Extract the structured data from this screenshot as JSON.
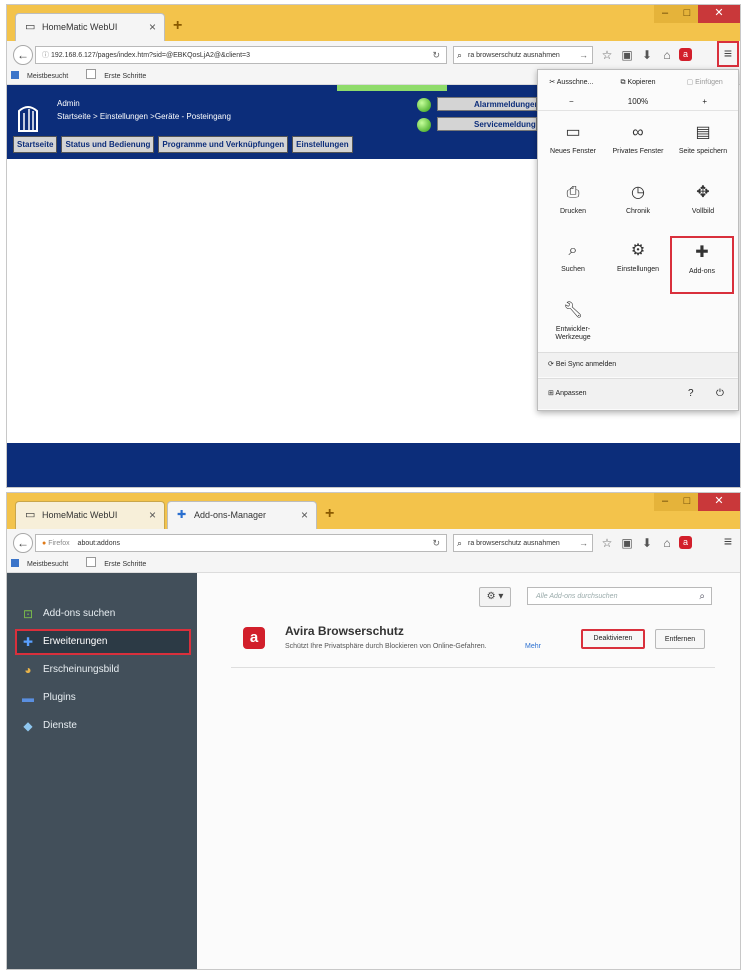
{
  "shot1": {
    "tabs": [
      {
        "label": "HomeMatic WebUI",
        "active": true
      }
    ],
    "new_tab": "+",
    "window_controls": {
      "minimize": "–",
      "maximize": "□",
      "close": "✕"
    },
    "url": "192.168.6.127/pages/index.htm?sid=@EBKQosLjA2@&client=3",
    "search_value": "ra browserschutz ausnahmen",
    "bookmarks": [
      "Meistbesucht",
      "Erste Schritte"
    ],
    "homematic": {
      "user": "Admin",
      "breadcrumb": "Startseite > Einstellungen >Geräte - Posteingang",
      "nav_tabs": [
        "Startseite",
        "Status und Bedienung",
        "Programme und Verknüpfungen",
        "Einstellungen"
      ],
      "status_buttons": [
        "Alarmmeldungen",
        "Servicemeldungen"
      ],
      "status_color": "#3fbe1a",
      "header_color": "#0c2d7a"
    },
    "menu_panel": {
      "edit_buttons": [
        "Ausschne...",
        "Kopieren",
        "Einfügen"
      ],
      "zoom": {
        "minus": "−",
        "level": "100%",
        "plus": "+"
      },
      "items": [
        {
          "label": "Neues Fenster",
          "icon": "window-icon"
        },
        {
          "label": "Privates Fenster",
          "icon": "mask-icon"
        },
        {
          "label": "Seite speichern",
          "icon": "save-page-icon"
        },
        {
          "label": "Drucken",
          "icon": "printer-icon"
        },
        {
          "label": "Chronik",
          "icon": "history-clock-icon"
        },
        {
          "label": "Vollbild",
          "icon": "fullscreen-icon"
        },
        {
          "label": "Suchen",
          "icon": "search-icon"
        },
        {
          "label": "Einstellungen",
          "icon": "gear-icon"
        },
        {
          "label": "Add-ons",
          "icon": "puzzle-icon",
          "highlighted": true
        },
        {
          "label": "Entwickler-Werkzeuge",
          "icon": "wrench-icon"
        }
      ],
      "sync": "Bei Sync anmelden",
      "customize": "Anpassen",
      "help": "?",
      "quit": "⏻"
    },
    "highlight_color": "#d9303c"
  },
  "shot2": {
    "tabs": [
      {
        "label": "HomeMatic WebUI",
        "active": false
      },
      {
        "label": "Add-ons-Manager",
        "active": true
      }
    ],
    "new_tab": "+",
    "window_controls": {
      "minimize": "–",
      "maximize": "□",
      "close": "✕"
    },
    "identity": "Firefox",
    "url": "about:addons",
    "search_value": "ra browserschutz ausnahmen",
    "bookmarks": [
      "Meistbesucht",
      "Erste Schritte"
    ],
    "categories": [
      {
        "label": "Add-ons suchen",
        "icon": "shopping-bag-icon",
        "selected": false
      },
      {
        "label": "Erweiterungen",
        "icon": "puzzle-icon",
        "selected": true
      },
      {
        "label": "Erscheinungsbild",
        "icon": "palette-icon",
        "selected": false
      },
      {
        "label": "Plugins",
        "icon": "plugin-brick-icon",
        "selected": false
      },
      {
        "label": "Dienste",
        "icon": "chat-bubble-icon",
        "selected": false
      }
    ],
    "gear": "⚙ ▾",
    "search_placeholder": "Alle Add-ons durchsuchen",
    "addon": {
      "name": "Avira Browserschutz",
      "description": "Schützt Ihre Privatsphäre durch Blockieren von Online-Gefahren.",
      "more": "Mehr",
      "disable_label": "Deaktivieren",
      "remove_label": "Entfernen",
      "logo_letter": "а"
    },
    "sidebar_color": "#424f5a"
  }
}
